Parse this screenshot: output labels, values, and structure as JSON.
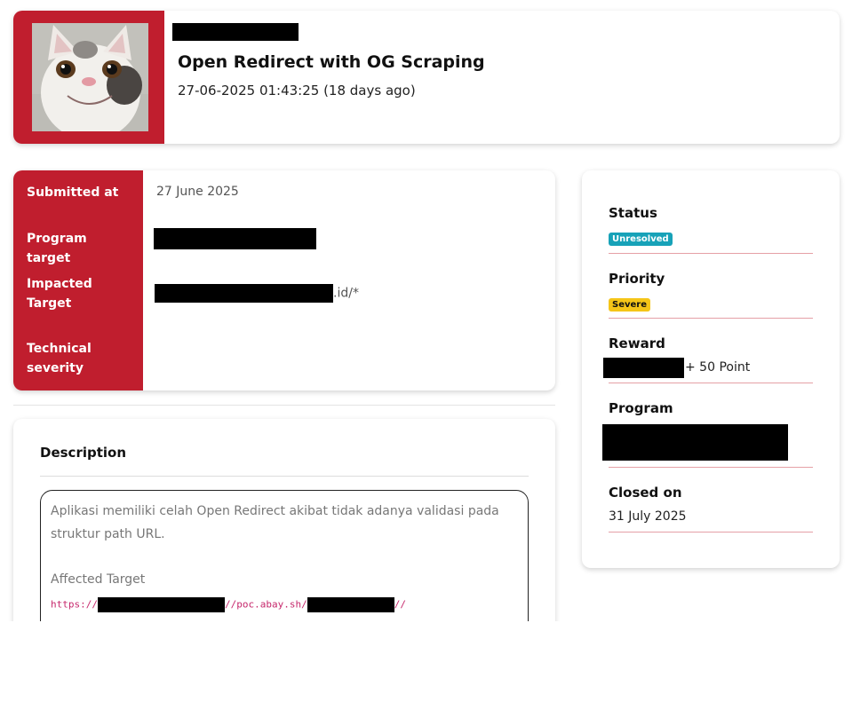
{
  "header": {
    "title": "Open Redirect with OG Scraping",
    "date": "27-06-2025 01:43:25 (18 days ago)"
  },
  "info": {
    "submitted_label": "Submitted at",
    "submitted_value": "27 June 2025",
    "program_target_label": "Program target",
    "impacted_label": "Impacted Target",
    "impacted_suffix": ".id/*",
    "severity_label": "Technical severity"
  },
  "description": {
    "heading": "Description",
    "text": "Aplikasi memiliki celah Open Redirect akibat tidak adanya validasi pada struktur path URL.",
    "affected_label": "Affected Target",
    "url_prefix": "https://",
    "url_middle": "//poc.abay.sh/",
    "url_suffix": "//"
  },
  "sidebar": {
    "status_label": "Status",
    "status_badge": "Unresolved",
    "priority_label": "Priority",
    "priority_badge": "Severe",
    "reward_label": "Reward",
    "reward_points": "+ 50 Point",
    "program_label": "Program",
    "closed_label": "Closed on",
    "closed_value": "31 July 2025"
  },
  "colors": {
    "brand_red": "#c01e2e",
    "status_badge": "#17a2b8",
    "priority_badge": "#f5c518",
    "url_text": "#c6286c"
  }
}
